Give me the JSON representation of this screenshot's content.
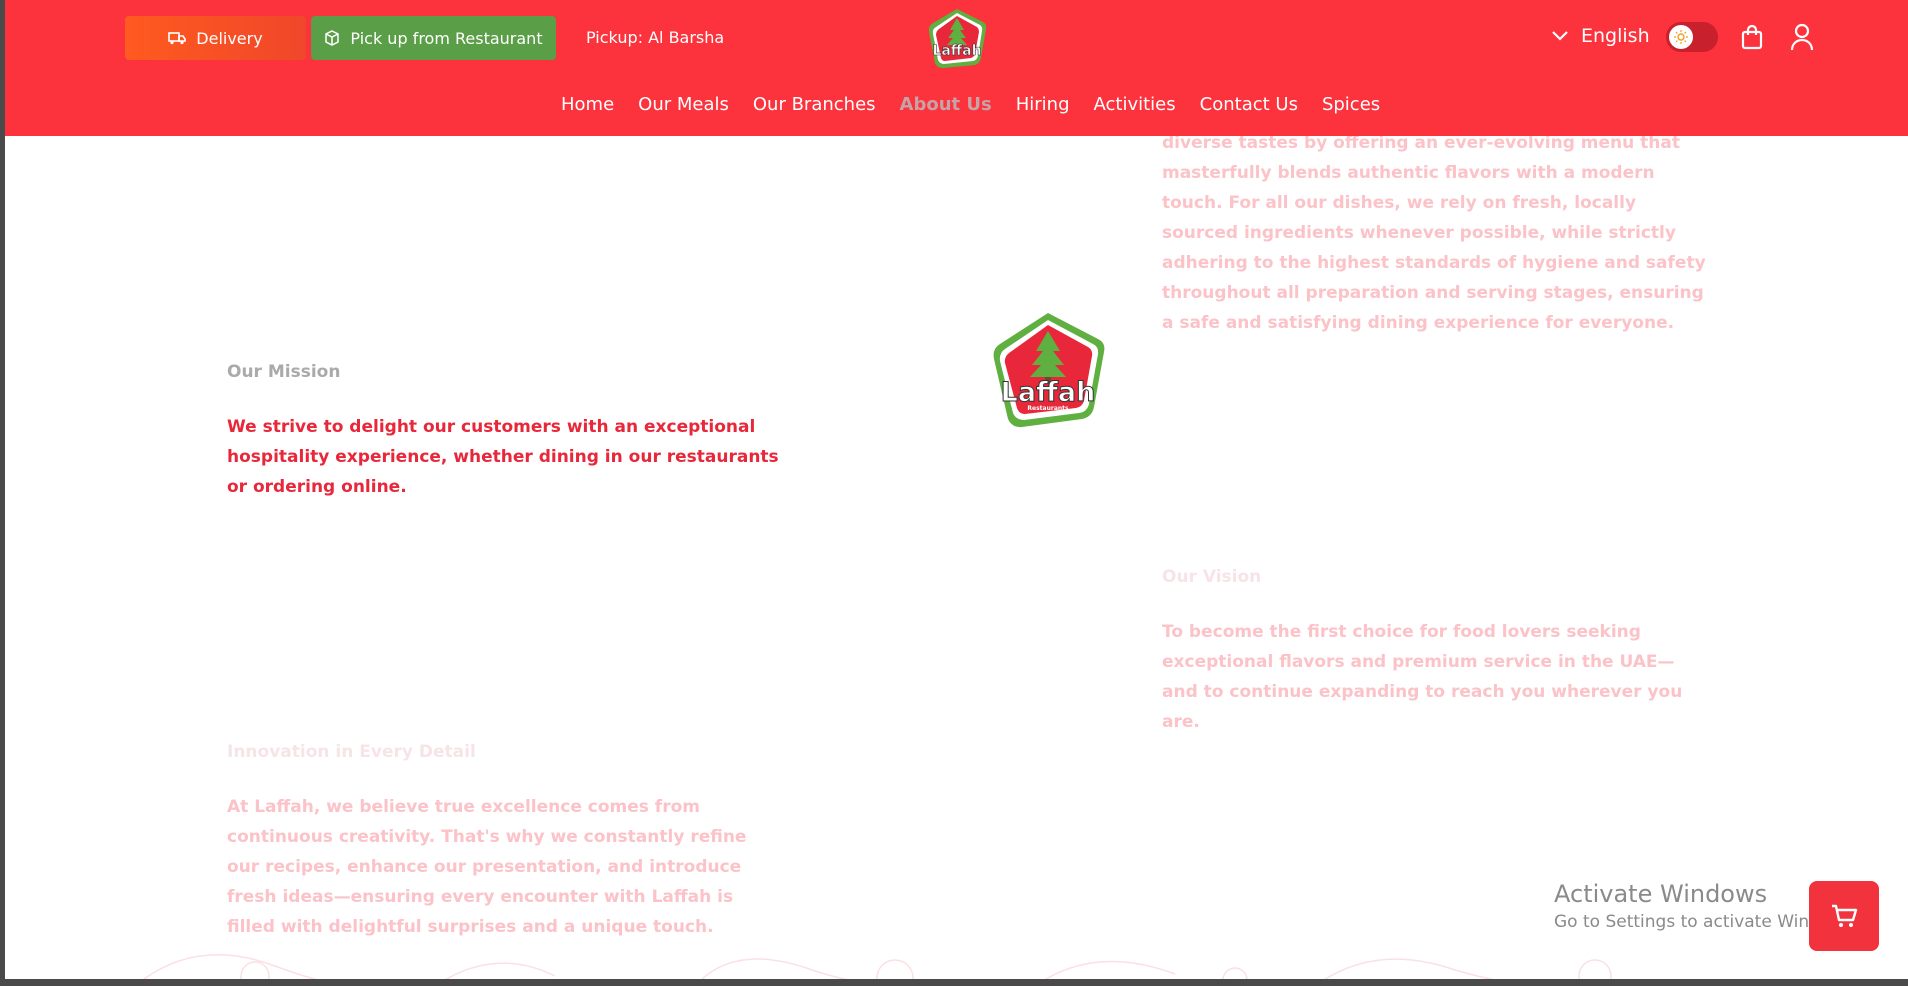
{
  "header": {
    "delivery_label": "Delivery",
    "pickup_label": "Pick up from Restaurant",
    "pickup_location": "Pickup: Al Barsha",
    "language": "English",
    "logo_text": "Laffah"
  },
  "nav": {
    "items": [
      "Home",
      "Our Meals",
      "Our Branches",
      "About Us",
      "Hiring",
      "Activities",
      "Contact Us",
      "Spices"
    ],
    "active": "About Us"
  },
  "content": {
    "intro_lines": "diverse tastes by offering an ever-evolving menu that masterfully blends authentic flavors with a modern touch. For all our dishes, we rely on fresh, locally sourced ingredients whenever possible, while strictly adhering to the highest standards of hygiene and safety throughout all preparation and serving stages, ensuring a safe and satisfying dining experience for everyone.",
    "mission_title": "Our Mission",
    "mission_text": "We strive to delight our customers with an exceptional hospitality experience, whether dining in our restaurants or ordering online.",
    "vision_title": "Our Vision",
    "vision_text": "To become the first choice for food lovers seeking exceptional flavors and premium service in the UAE—and to continue expanding to reach you wherever you are.",
    "innovation_title": "Innovation in Every Detail",
    "innovation_text": "At Laffah, we believe true excellence comes from continuous creativity. That's why we constantly refine our recipes, enhance our presentation, and introduce fresh ideas—ensuring every encounter with Laffah is filled with delightful surprises and a unique touch.",
    "logo_text": "Laffah",
    "logo_subtext": "Restaurants"
  },
  "windows": {
    "activate_title": "Activate Windows",
    "activate_sub": "Go to Settings to activate Windows."
  },
  "colors": {
    "brand_red": "#fc323d",
    "pickup_green": "#5a9e48",
    "delivery_orange": "#ff5a1f"
  }
}
